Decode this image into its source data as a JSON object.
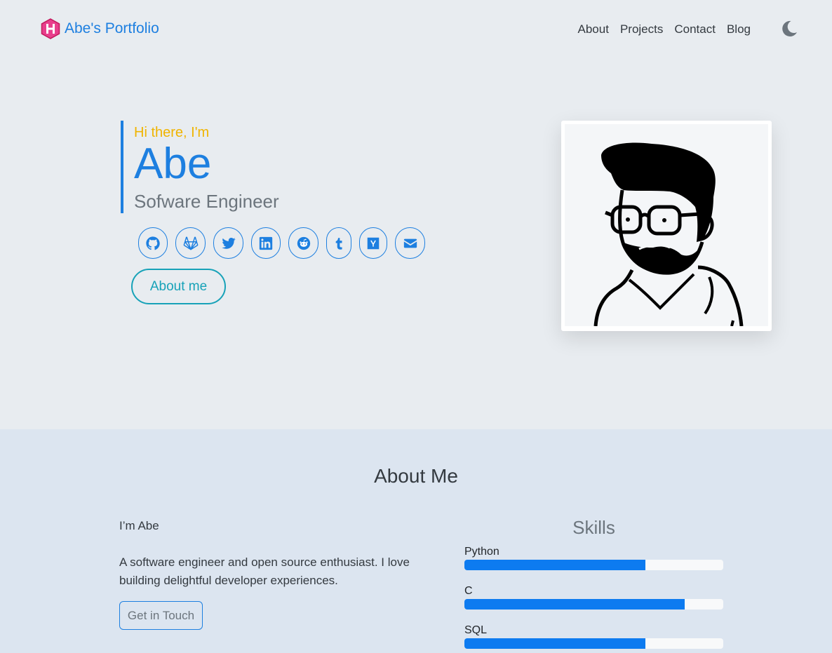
{
  "navbar": {
    "brand_text": "Abe's Portfolio",
    "logo_icon": "hexagon-h-logo-icon",
    "links": [
      "About",
      "Projects",
      "Contact",
      "Blog"
    ],
    "theme_icon": "moon-icon"
  },
  "hero": {
    "greeting": "Hi there, I'm",
    "name": "Abe",
    "role": "Sofware Engineer",
    "socials": [
      {
        "icon": "github-icon"
      },
      {
        "icon": "gitlab-icon"
      },
      {
        "icon": "twitter-icon"
      },
      {
        "icon": "linkedin-icon"
      },
      {
        "icon": "reddit-icon"
      },
      {
        "icon": "tumblr-icon"
      },
      {
        "icon": "hacker-news-icon"
      },
      {
        "icon": "email-icon"
      }
    ],
    "about_button": "About me",
    "portrait": "cartoon-avatar-portrait"
  },
  "about": {
    "title": "About Me",
    "intro": "I’m Abe",
    "bio": "A software engineer and open source enthusiast. I love building delightful developer experiences.",
    "contact_button": "Get in Touch",
    "skills_title": "Skills",
    "skills": [
      {
        "name": "Python",
        "level": 0.7
      },
      {
        "name": "C",
        "level": 0.85
      },
      {
        "name": "SQL",
        "level": 0.7
      }
    ]
  },
  "colors": {
    "accent": "#1d7fe0",
    "greeting": "#f0b400",
    "teal": "#17a2b8",
    "logo": "#e83e8c"
  }
}
